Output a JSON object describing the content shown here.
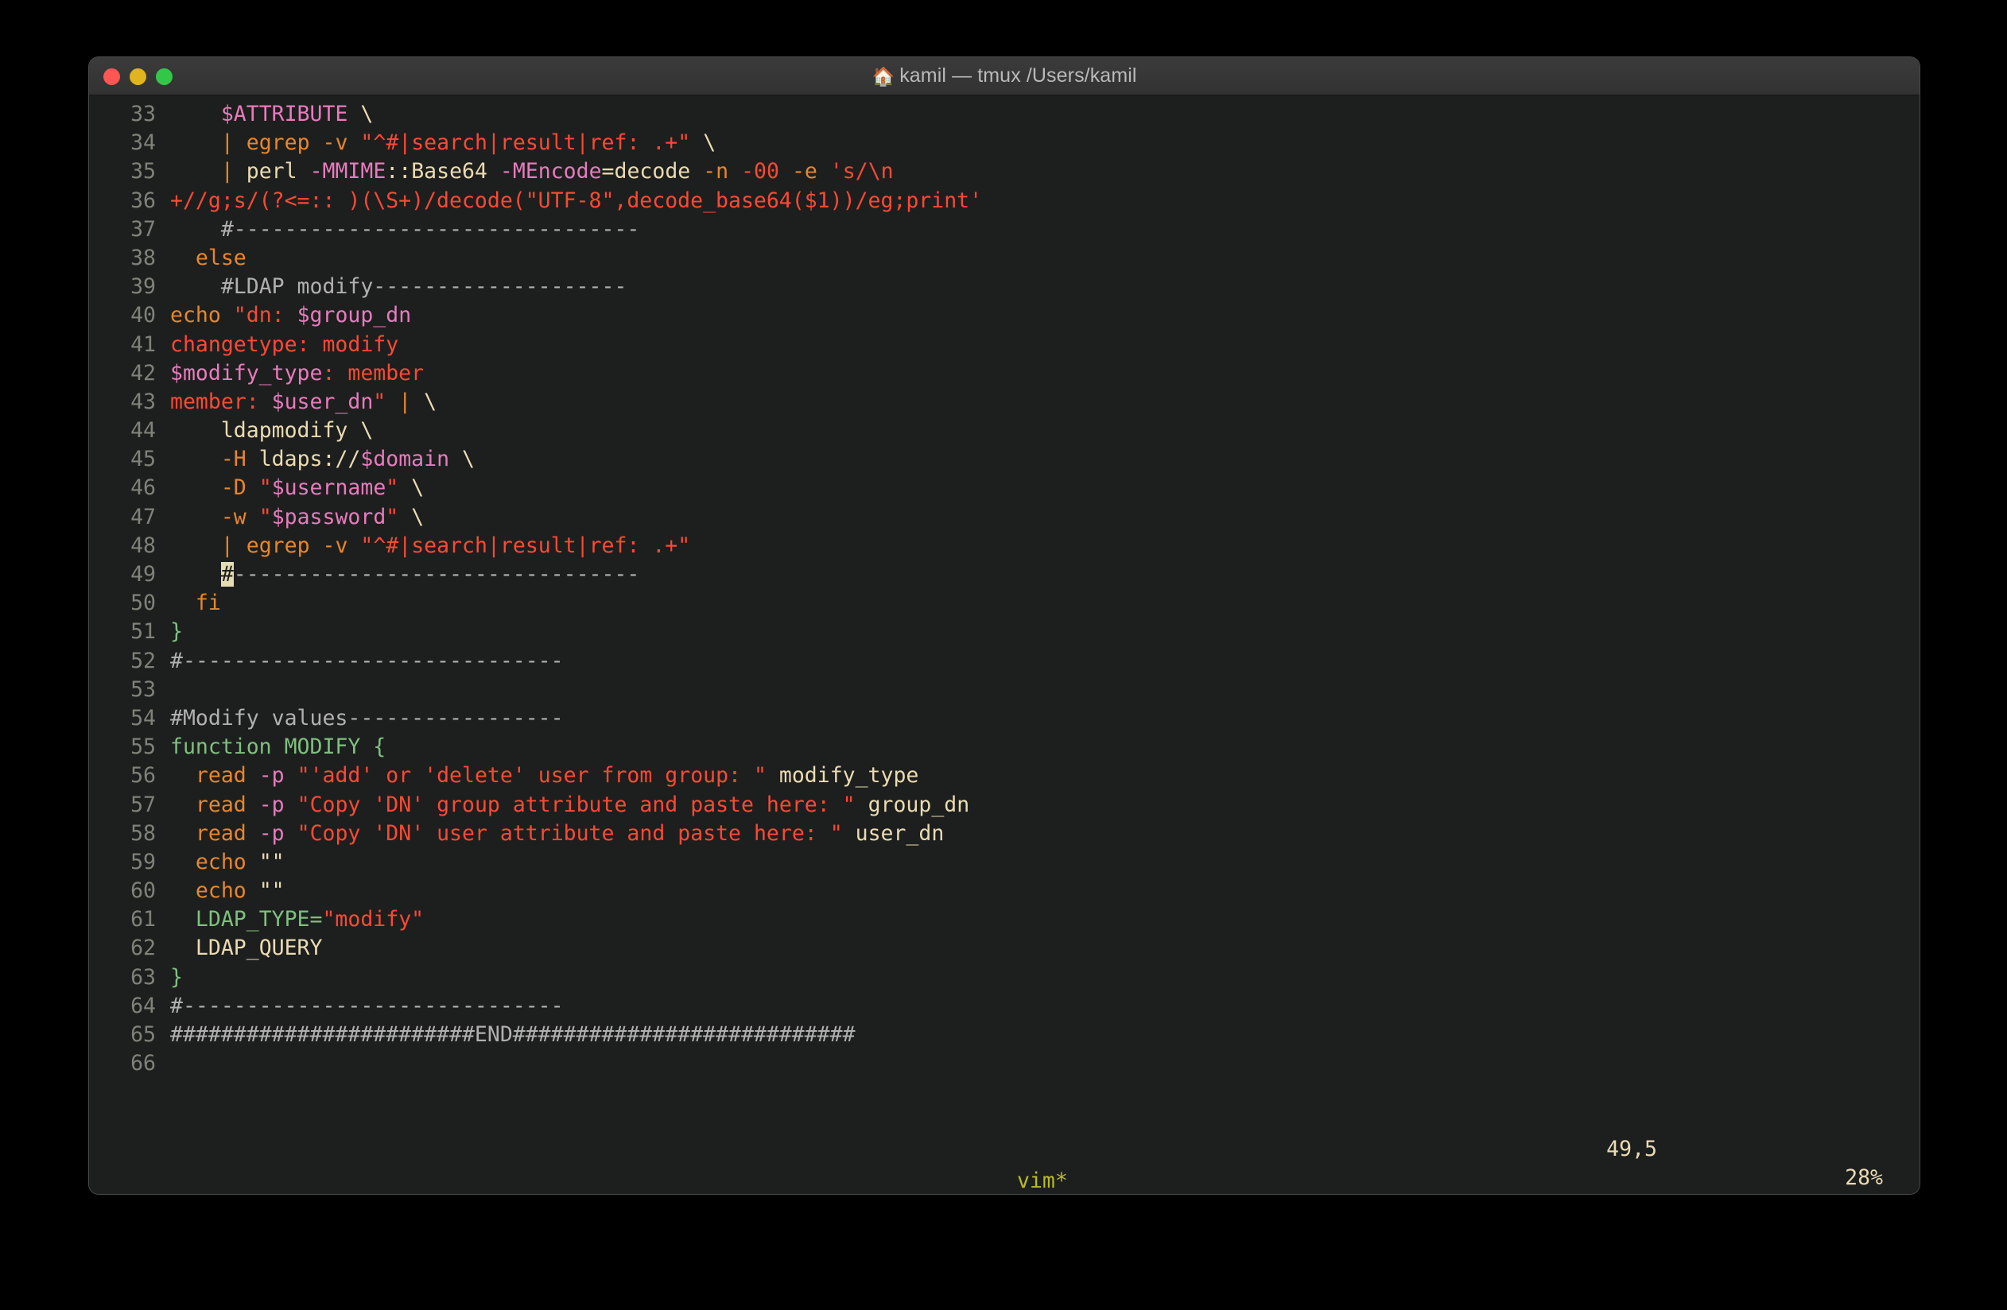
{
  "window": {
    "title": "kamil — tmux /Users/kamil",
    "title_emoji": "🏠",
    "traffic_lights": {
      "close": "close-button",
      "minimize": "minimize-button",
      "maximize": "maximize-button"
    },
    "colors": {
      "background": "#1d1f1e",
      "titlebar": "#353535",
      "desktop": "#000000",
      "close": "#fc5753",
      "minimize": "#e0b321",
      "maximize": "#33c748",
      "linenumber": "#7f8279",
      "comment": "#b0b0b0",
      "string": "#fb4934",
      "variable": "#e87bbd",
      "keyword": "#e8862b",
      "function": "#7fc07f",
      "default": "#ebdbb2",
      "cursor": "#e6dcb4",
      "tmux_status": "#b9bb26"
    }
  },
  "editor": {
    "app": "vim",
    "lines": [
      {
        "n": "33",
        "tokens": [
          {
            "t": "    ",
            "c": "c-def"
          },
          {
            "t": "$ATTRIBUTE",
            "c": "c-var"
          },
          {
            "t": " ",
            "c": "c-def"
          },
          {
            "t": "\\",
            "c": "c-def"
          }
        ]
      },
      {
        "n": "34",
        "tokens": [
          {
            "t": "    ",
            "c": "c-def"
          },
          {
            "t": "|",
            "c": "c-kw"
          },
          {
            "t": " ",
            "c": "c-def"
          },
          {
            "t": "egrep",
            "c": "c-kw"
          },
          {
            "t": " ",
            "c": "c-def"
          },
          {
            "t": "-v",
            "c": "c-flag"
          },
          {
            "t": " ",
            "c": "c-def"
          },
          {
            "t": "\"^#|search|result|ref: .+\"",
            "c": "c-str"
          },
          {
            "t": " ",
            "c": "c-def"
          },
          {
            "t": "\\",
            "c": "c-def"
          }
        ]
      },
      {
        "n": "35",
        "tokens": [
          {
            "t": "    ",
            "c": "c-def"
          },
          {
            "t": "|",
            "c": "c-kw"
          },
          {
            "t": " ",
            "c": "c-def"
          },
          {
            "t": "perl",
            "c": "c-def"
          },
          {
            "t": " ",
            "c": "c-def"
          },
          {
            "t": "-MMIME",
            "c": "c-var"
          },
          {
            "t": "::Base64",
            "c": "c-def"
          },
          {
            "t": " ",
            "c": "c-def"
          },
          {
            "t": "-MEncode",
            "c": "c-var"
          },
          {
            "t": "=decode",
            "c": "c-def"
          },
          {
            "t": " ",
            "c": "c-def"
          },
          {
            "t": "-n",
            "c": "c-flag"
          },
          {
            "t": " ",
            "c": "c-def"
          },
          {
            "t": "-00",
            "c": "c-str"
          },
          {
            "t": " ",
            "c": "c-def"
          },
          {
            "t": "-e",
            "c": "c-flag"
          },
          {
            "t": " ",
            "c": "c-def"
          },
          {
            "t": "'s/\\n",
            "c": "c-str"
          }
        ]
      },
      {
        "n": "36",
        "tokens": [
          {
            "t": "+//g;s/(?<=:: )(\\S+)/decode(\"UTF-8\",decode_base64($1))/eg;print'",
            "c": "c-str"
          }
        ]
      },
      {
        "n": "37",
        "tokens": [
          {
            "t": "    ",
            "c": "c-def"
          },
          {
            "t": "#--------------------------------",
            "c": "c-cmt"
          }
        ]
      },
      {
        "n": "38",
        "tokens": [
          {
            "t": "  ",
            "c": "c-def"
          },
          {
            "t": "else",
            "c": "c-kw"
          }
        ]
      },
      {
        "n": "39",
        "tokens": [
          {
            "t": "    ",
            "c": "c-def"
          },
          {
            "t": "#LDAP modify--------------------",
            "c": "c-cmt"
          }
        ]
      },
      {
        "n": "40",
        "tokens": [
          {
            "t": "echo",
            "c": "c-kw"
          },
          {
            "t": " ",
            "c": "c-def"
          },
          {
            "t": "\"dn: ",
            "c": "c-str"
          },
          {
            "t": "$group_dn",
            "c": "c-var"
          }
        ]
      },
      {
        "n": "41",
        "tokens": [
          {
            "t": "changetype: modify",
            "c": "c-str"
          }
        ]
      },
      {
        "n": "42",
        "tokens": [
          {
            "t": "$modify_type",
            "c": "c-var"
          },
          {
            "t": ": member",
            "c": "c-str"
          }
        ]
      },
      {
        "n": "43",
        "tokens": [
          {
            "t": "member: ",
            "c": "c-str"
          },
          {
            "t": "$user_dn",
            "c": "c-var"
          },
          {
            "t": "\"",
            "c": "c-str"
          },
          {
            "t": " ",
            "c": "c-def"
          },
          {
            "t": "|",
            "c": "c-kw"
          },
          {
            "t": " ",
            "c": "c-def"
          },
          {
            "t": "\\",
            "c": "c-def"
          }
        ]
      },
      {
        "n": "44",
        "tokens": [
          {
            "t": "    ",
            "c": "c-def"
          },
          {
            "t": "ldapmodify \\",
            "c": "c-def"
          }
        ]
      },
      {
        "n": "45",
        "tokens": [
          {
            "t": "    ",
            "c": "c-def"
          },
          {
            "t": "-H",
            "c": "c-flag"
          },
          {
            "t": " ",
            "c": "c-def"
          },
          {
            "t": "ldaps://",
            "c": "c-def"
          },
          {
            "t": "$domain",
            "c": "c-var"
          },
          {
            "t": " \\",
            "c": "c-def"
          }
        ]
      },
      {
        "n": "46",
        "tokens": [
          {
            "t": "    ",
            "c": "c-def"
          },
          {
            "t": "-D",
            "c": "c-flag"
          },
          {
            "t": " ",
            "c": "c-def"
          },
          {
            "t": "\"",
            "c": "c-str"
          },
          {
            "t": "$username",
            "c": "c-var"
          },
          {
            "t": "\"",
            "c": "c-str"
          },
          {
            "t": " \\",
            "c": "c-def"
          }
        ]
      },
      {
        "n": "47",
        "tokens": [
          {
            "t": "    ",
            "c": "c-def"
          },
          {
            "t": "-w",
            "c": "c-flag"
          },
          {
            "t": " ",
            "c": "c-def"
          },
          {
            "t": "\"",
            "c": "c-str"
          },
          {
            "t": "$password",
            "c": "c-var"
          },
          {
            "t": "\"",
            "c": "c-str"
          },
          {
            "t": " \\",
            "c": "c-def"
          }
        ]
      },
      {
        "n": "48",
        "tokens": [
          {
            "t": "    ",
            "c": "c-def"
          },
          {
            "t": "|",
            "c": "c-kw"
          },
          {
            "t": " ",
            "c": "c-def"
          },
          {
            "t": "egrep",
            "c": "c-kw"
          },
          {
            "t": " ",
            "c": "c-def"
          },
          {
            "t": "-v",
            "c": "c-flag"
          },
          {
            "t": " ",
            "c": "c-def"
          },
          {
            "t": "\"^#|search|result|ref: .+\"",
            "c": "c-str"
          }
        ]
      },
      {
        "n": "49",
        "tokens": [
          {
            "t": "    ",
            "c": "c-def"
          },
          {
            "t": "#",
            "c": "cursor"
          },
          {
            "t": "--------------------------------",
            "c": "c-cmt"
          }
        ]
      },
      {
        "n": "50",
        "tokens": [
          {
            "t": "  ",
            "c": "c-def"
          },
          {
            "t": "fi",
            "c": "c-kw"
          }
        ]
      },
      {
        "n": "51",
        "tokens": [
          {
            "t": "}",
            "c": "c-fn"
          }
        ]
      },
      {
        "n": "52",
        "tokens": [
          {
            "t": "#------------------------------",
            "c": "c-cmt"
          }
        ]
      },
      {
        "n": "53",
        "tokens": []
      },
      {
        "n": "54",
        "tokens": [
          {
            "t": "#Modify values-----------------",
            "c": "c-cmt"
          }
        ]
      },
      {
        "n": "55",
        "tokens": [
          {
            "t": "function MODIFY {",
            "c": "c-fn"
          }
        ]
      },
      {
        "n": "56",
        "tokens": [
          {
            "t": "  ",
            "c": "c-def"
          },
          {
            "t": "read",
            "c": "c-kw"
          },
          {
            "t": " ",
            "c": "c-def"
          },
          {
            "t": "-p",
            "c": "c-var"
          },
          {
            "t": " ",
            "c": "c-def"
          },
          {
            "t": "\"'add' or 'delete' user from group: \"",
            "c": "c-str"
          },
          {
            "t": " modify_type",
            "c": "c-def"
          }
        ]
      },
      {
        "n": "57",
        "tokens": [
          {
            "t": "  ",
            "c": "c-def"
          },
          {
            "t": "read",
            "c": "c-kw"
          },
          {
            "t": " ",
            "c": "c-def"
          },
          {
            "t": "-p",
            "c": "c-var"
          },
          {
            "t": " ",
            "c": "c-def"
          },
          {
            "t": "\"Copy 'DN' group attribute and paste here: \"",
            "c": "c-str"
          },
          {
            "t": " group_dn",
            "c": "c-def"
          }
        ]
      },
      {
        "n": "58",
        "tokens": [
          {
            "t": "  ",
            "c": "c-def"
          },
          {
            "t": "read",
            "c": "c-kw"
          },
          {
            "t": " ",
            "c": "c-def"
          },
          {
            "t": "-p",
            "c": "c-var"
          },
          {
            "t": " ",
            "c": "c-def"
          },
          {
            "t": "\"Copy 'DN' user attribute and paste here: \"",
            "c": "c-str"
          },
          {
            "t": " user_dn",
            "c": "c-def"
          }
        ]
      },
      {
        "n": "59",
        "tokens": [
          {
            "t": "  ",
            "c": "c-def"
          },
          {
            "t": "echo",
            "c": "c-kw"
          },
          {
            "t": " ",
            "c": "c-def"
          },
          {
            "t": "\"\"",
            "c": "c-def"
          }
        ]
      },
      {
        "n": "60",
        "tokens": [
          {
            "t": "  ",
            "c": "c-def"
          },
          {
            "t": "echo",
            "c": "c-kw"
          },
          {
            "t": " ",
            "c": "c-def"
          },
          {
            "t": "\"\"",
            "c": "c-def"
          }
        ]
      },
      {
        "n": "61",
        "tokens": [
          {
            "t": "  ",
            "c": "c-def"
          },
          {
            "t": "LDAP_TYPE=",
            "c": "c-fn"
          },
          {
            "t": "\"modify\"",
            "c": "c-str"
          }
        ]
      },
      {
        "n": "62",
        "tokens": [
          {
            "t": "  ",
            "c": "c-def"
          },
          {
            "t": "LDAP_QUERY",
            "c": "c-def"
          }
        ]
      },
      {
        "n": "63",
        "tokens": [
          {
            "t": "}",
            "c": "c-fn"
          }
        ]
      },
      {
        "n": "64",
        "tokens": [
          {
            "t": "#------------------------------",
            "c": "c-cmt"
          }
        ]
      },
      {
        "n": "65",
        "tokens": [
          {
            "t": "########################END###########################",
            "c": "c-cmt"
          }
        ]
      },
      {
        "n": "66",
        "tokens": []
      }
    ],
    "ruler_position": "49,5",
    "ruler_percent": "28%"
  },
  "tmux": {
    "window_label": "vim*"
  }
}
